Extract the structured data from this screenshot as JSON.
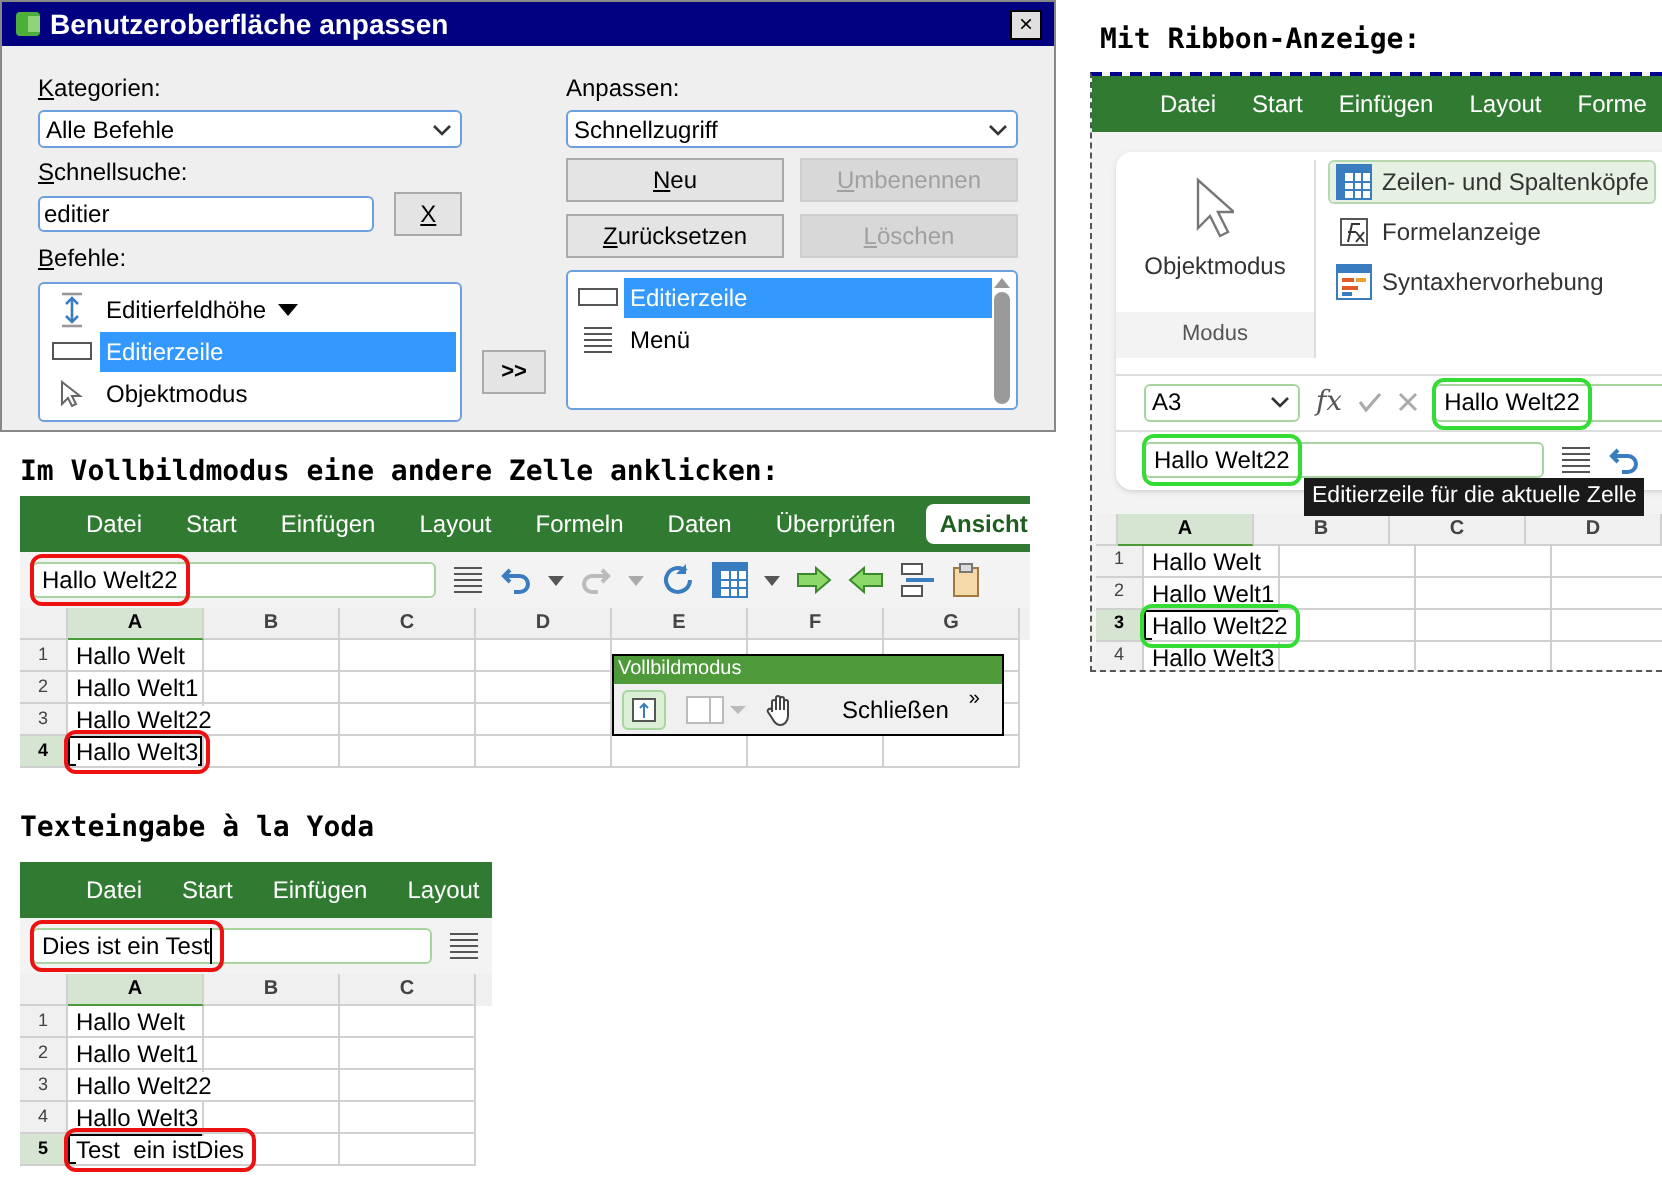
{
  "dialog": {
    "title": "Benutzeroberfläche anpassen",
    "close": "×",
    "categories_label": "Kategorien:",
    "categories_value": "Alle Befehle",
    "search_label": "Schnellsuche:",
    "search_value": "editier",
    "clear_button": "X",
    "commands_label": "Befehle:",
    "commands": [
      {
        "label": "Editierfeldhöhe",
        "kind": "dropdown",
        "selected": false
      },
      {
        "label": "Editierzeile",
        "kind": "field",
        "selected": true
      },
      {
        "label": "Objektmodus",
        "kind": "pointer",
        "selected": false
      }
    ],
    "add_button": ">>",
    "customize_label": "Anpassen:",
    "customize_value": "Schnellzugriff",
    "buttons": [
      {
        "label": "Neu",
        "disabled": false
      },
      {
        "label": "Umbenennen",
        "disabled": true
      },
      {
        "label": "Zurücksetzen",
        "disabled": false
      },
      {
        "label": "Löschen",
        "disabled": true
      }
    ],
    "entries": [
      {
        "label": "Editierzeile",
        "kind": "field",
        "selected": true
      },
      {
        "label": "Menü",
        "kind": "lines",
        "selected": false
      }
    ]
  },
  "ribbon_demo": {
    "heading": "Mit Ribbon-Anzeige:",
    "tabs": [
      {
        "label": "Datei",
        "selected": false
      },
      {
        "label": "Start",
        "selected": false
      },
      {
        "label": "Einfügen",
        "selected": false
      },
      {
        "label": "Layout",
        "selected": false
      },
      {
        "label": "Forme",
        "selected": false
      }
    ],
    "mode_button": "Objektmodus",
    "group_label": "Modus",
    "options": [
      {
        "label": "Zeilen- und Spaltenköpfe",
        "kind": "headers",
        "selected": true
      },
      {
        "label": "Formelanzeige",
        "kind": "formula",
        "selected": false
      },
      {
        "label": "Syntaxhervorhebung",
        "kind": "syntax",
        "selected": false
      }
    ],
    "name_box": "A3",
    "fx": "fx",
    "formula_value": "Hallo Welt22",
    "edit_line": "Hallo Welt22",
    "tooltip": "Editierzeile für die aktuelle Zelle",
    "columns": [
      "A",
      "B",
      "C",
      "D"
    ],
    "rows": [
      {
        "number": "1",
        "cell": "Hallo Welt",
        "selected": false
      },
      {
        "number": "2",
        "cell": "Hallo Welt1",
        "selected": false
      },
      {
        "number": "3",
        "cell": "Hallo Welt22",
        "selected": true
      },
      {
        "number": "4",
        "cell": "Hallo Welt3",
        "selected": false
      }
    ]
  },
  "fullscreen_demo": {
    "heading": "Im Vollbildmodus eine andere Zelle anklicken:",
    "tabs": [
      {
        "label": "Datei",
        "selected": false
      },
      {
        "label": "Start",
        "selected": false
      },
      {
        "label": "Einfügen",
        "selected": false
      },
      {
        "label": "Layout",
        "selected": false
      },
      {
        "label": "Formeln",
        "selected": false
      },
      {
        "label": "Daten",
        "selected": false
      },
      {
        "label": "Überprüfen",
        "selected": false
      },
      {
        "label": "Ansicht",
        "selected": true
      }
    ],
    "edit_line": "Hallo Welt22",
    "columns": [
      "A",
      "B",
      "C",
      "D",
      "E",
      "F",
      "G"
    ],
    "rows": [
      {
        "number": "1",
        "cell": "Hallo Welt",
        "selected": false
      },
      {
        "number": "2",
        "cell": "Hallo Welt1",
        "selected": false
      },
      {
        "number": "3",
        "cell": "Hallo Welt22",
        "selected": false
      },
      {
        "number": "4",
        "cell": "Hallo Welt3",
        "selected": true
      }
    ],
    "floating_toolbar": {
      "title": "Vollbildmodus",
      "close_label": "Schließen",
      "more": "»"
    }
  },
  "yoda_demo": {
    "heading": "Texteingabe à la Yoda",
    "tabs": [
      {
        "label": "Datei",
        "selected": false
      },
      {
        "label": "Start",
        "selected": false
      },
      {
        "label": "Einfügen",
        "selected": false
      },
      {
        "label": "Layout",
        "selected": false
      }
    ],
    "edit_line": "Dies ist ein Test",
    "columns": [
      "A",
      "B",
      "C"
    ],
    "rows": [
      {
        "number": "1",
        "cell": "Hallo Welt",
        "selected": false
      },
      {
        "number": "2",
        "cell": "Hallo Welt1",
        "selected": false
      },
      {
        "number": "3",
        "cell": "Hallo Welt22",
        "selected": false
      },
      {
        "number": "4",
        "cell": "Hallo Welt3",
        "selected": false
      },
      {
        "number": "5",
        "cell": "Test  ein istDies",
        "selected": true
      }
    ]
  }
}
